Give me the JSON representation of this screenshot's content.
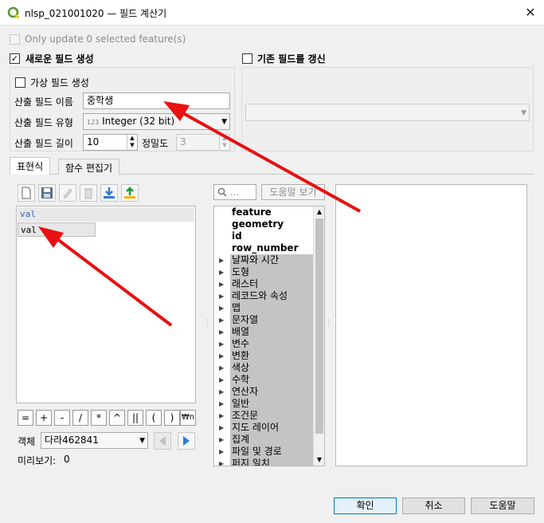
{
  "window": {
    "title": "nlsp_021001020 — 필드 계산기",
    "close_glyph": "✕"
  },
  "only_update": {
    "label": "Only update 0 selected feature(s)",
    "checked": false,
    "enabled": false
  },
  "new_field": {
    "label": "새로운 필드 생성",
    "checked": true,
    "virtual_label": "가상 필드 생성",
    "virtual_checked": false,
    "name_label": "산출 필드 이름",
    "name_value": "중학생",
    "type_label": "산출 필드 유형",
    "type_badge": "123",
    "type_value": "Integer (32 bit)",
    "length_label": "산출 필드 길이",
    "length_value": "10",
    "precision_label": "정밀도",
    "precision_value": "3"
  },
  "update_field": {
    "label": "기존 필드를 갱신",
    "checked": false
  },
  "tabs": [
    "표현식",
    "함수 편집기"
  ],
  "editor": {
    "lines": [
      "val"
    ],
    "autocomplete": "val"
  },
  "operators": [
    "=",
    "+",
    "-",
    "/",
    "*",
    "^",
    "||",
    "(",
    ")",
    "₩n"
  ],
  "feature": {
    "label": "객체",
    "value": "다라462841"
  },
  "preview": {
    "label": "미리보기:",
    "value": "0"
  },
  "function_search": {
    "placeholder": "...",
    "help_button": "도움말 보기"
  },
  "function_tree": {
    "top_items": [
      "feature",
      "geometry",
      "id",
      "row_number"
    ],
    "groups": [
      "날짜와 시간",
      "도형",
      "래스터",
      "레코드와 속성",
      "맵",
      "문자열",
      "배열",
      "변수",
      "변환",
      "색상",
      "수학",
      "연산자",
      "일반",
      "조건문",
      "지도 레이어",
      "집계",
      "파일 및 경로",
      "퍼지 일치"
    ]
  },
  "buttons": {
    "ok": "확인",
    "cancel": "취소",
    "help": "도움말"
  },
  "colors": {
    "arrow": "#e81010",
    "accent": "#2f7bd6",
    "qgis_green": "#589632"
  }
}
